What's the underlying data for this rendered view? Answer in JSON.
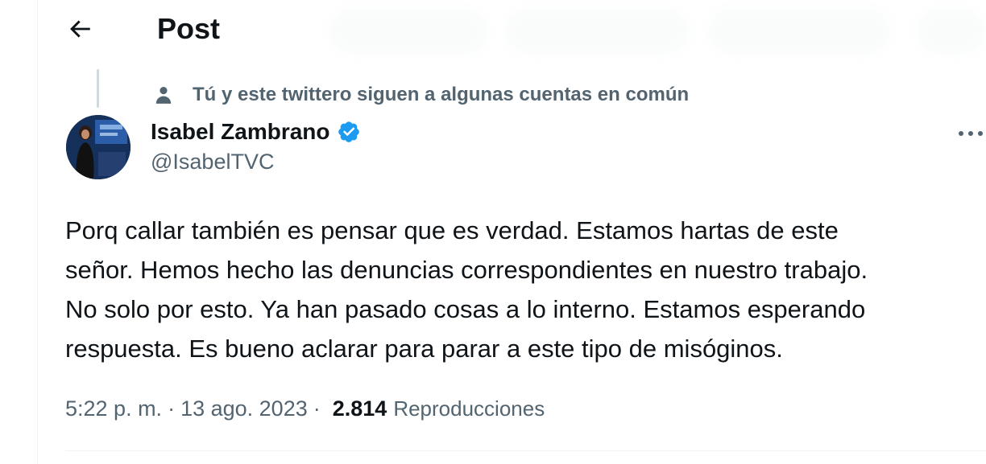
{
  "header": {
    "title": "Post",
    "back_icon": "arrow-left-icon"
  },
  "social_context": {
    "icon": "person-icon",
    "text": "Tú y este twittero siguen a algunas cuentas en común"
  },
  "author": {
    "name": "Isabel Zambrano",
    "handle": "@IsabelTVC",
    "verified": true,
    "verified_color": "#1d9bf0"
  },
  "tweet": {
    "text": "Porq callar también es pensar que es verdad. Estamos hartas de este\nseñor. Hemos hecho las denuncias correspondientes en nuestro trabajo.\nNo solo por esto. Ya han pasado cosas a lo interno. Estamos esperando\nrespuesta. Es bueno aclarar para parar a este tipo de misóginos."
  },
  "meta": {
    "time": "5:22 p. m.",
    "separator": "·",
    "date": "13 ago. 2023",
    "views_count": "2.814",
    "views_label": "Reproducciones"
  },
  "colors": {
    "text_primary": "#0f1419",
    "text_secondary": "#536471",
    "border": "#eff3f4",
    "accent": "#1d9bf0"
  }
}
